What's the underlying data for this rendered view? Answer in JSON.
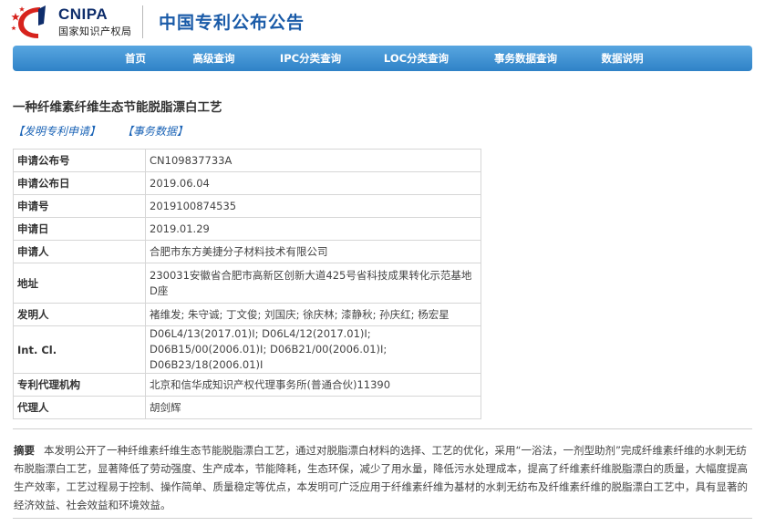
{
  "header": {
    "logo_en": "CNIPA",
    "logo_cn": "国家知识产权局",
    "site_title": "中国专利公布公告"
  },
  "nav": {
    "items": [
      "首页",
      "高级查询",
      "IPC分类查询",
      "LOC分类查询",
      "事务数据查询",
      "数据说明"
    ]
  },
  "patent": {
    "title": "一种纤维素纤维生态节能脱脂漂白工艺",
    "links": [
      "【发明专利申请】",
      "【事务数据】"
    ],
    "fields": [
      {
        "label": "申请公布号",
        "value": "CN109837733A"
      },
      {
        "label": "申请公布日",
        "value": "2019.06.04"
      },
      {
        "label": "申请号",
        "value": "2019100874535"
      },
      {
        "label": "申请日",
        "value": "2019.01.29"
      },
      {
        "label": "申请人",
        "value": "合肥市东方美捷分子材料技术有限公司"
      },
      {
        "label": "地址",
        "value": "230031安徽省合肥市高新区创新大道425号省科技成果转化示范基地D座"
      },
      {
        "label": "发明人",
        "value": "褚维发; 朱守诚; 丁文俊; 刘国庆; 徐庆林; 漆静秋; 孙庆红; 杨宏星"
      },
      {
        "label": "Int. Cl.",
        "value": "D06L4/13(2017.01)I; D06L4/12(2017.01)I; D06B15/00(2006.01)I; D06B21/00(2006.01)I; D06B23/18(2006.01)I"
      },
      {
        "label": "专利代理机构",
        "value": "北京和信华成知识产权代理事务所(普通合伙)11390"
      },
      {
        "label": "代理人",
        "value": "胡剑辉"
      }
    ],
    "abstract_label": "摘要",
    "abstract": "本发明公开了一种纤维素纤维生态节能脱脂漂白工艺，通过对脱脂漂白材料的选择、工艺的优化，采用“一浴法，一剂型助剂”完成纤维素纤维的水刺无纺布脱脂漂白工艺，显著降低了劳动强度、生产成本，节能降耗，生态环保，减少了用水量，降低污水处理成本，提高了纤维素纤维脱脂漂白的质量，大幅度提高生产效率，工艺过程易于控制、操作简单、质量稳定等优点，本发明可广泛应用于纤维素纤维为基材的水刺无纺布及纤维素纤维的脱脂漂白工艺中，具有显著的经济效益、社会效益和环境效益。"
  },
  "colors": {
    "nav_top": "#58a6e0",
    "nav_bottom": "#2f82c7",
    "title_blue": "#1a5ba8",
    "link_blue": "#1a63b6",
    "logo_red": "#d7231d",
    "logo_navy": "#0e2d6b"
  }
}
